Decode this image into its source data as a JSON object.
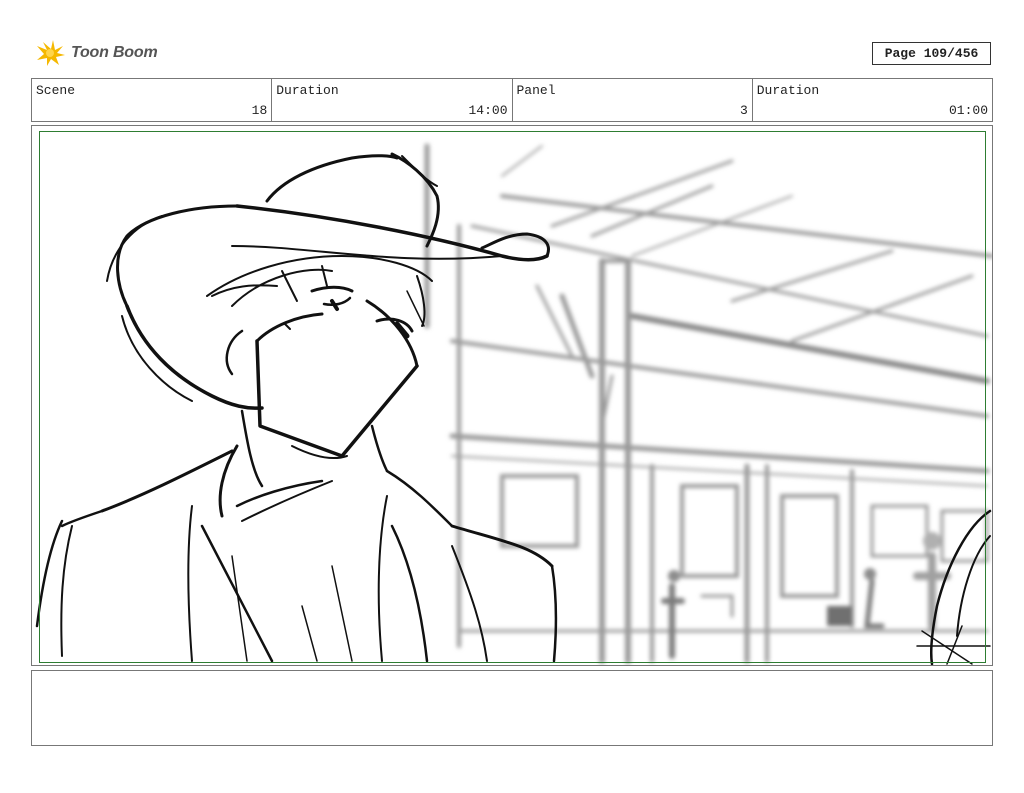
{
  "header": {
    "logo_text": "Toon Boom",
    "page_label": "Page 109/456"
  },
  "info": {
    "scene_label": "Scene",
    "scene_value": "18",
    "duration_label": "Duration",
    "duration_value": "14:00",
    "panel_label": "Panel",
    "panel_value": "3",
    "panel_duration_label": "Duration",
    "panel_duration_value": "01:00"
  },
  "notes": {
    "text": ""
  },
  "colors": {
    "logo_accent": "#f5b800",
    "safe_frame": "#2e7d32"
  }
}
